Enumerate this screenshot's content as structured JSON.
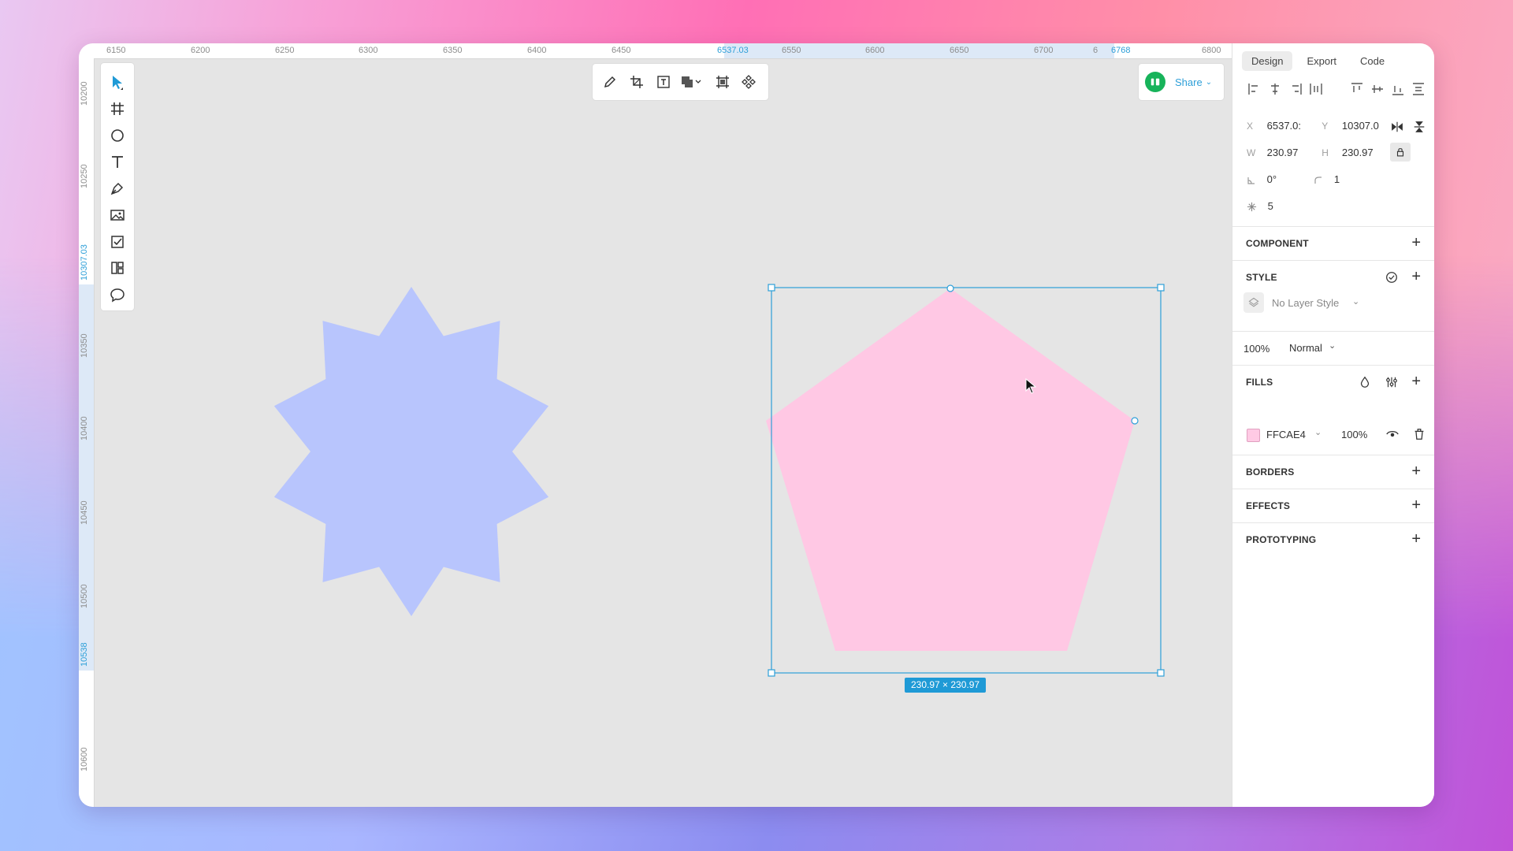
{
  "ruler_top": {
    "labels": [
      "6150",
      "6200",
      "6250",
      "6300",
      "6350",
      "6400",
      "6450",
      "6537.03",
      "6550",
      "6600",
      "6650",
      "6700",
      "6",
      "6768",
      "6800"
    ],
    "highlight": [
      "6537.03",
      "6768"
    ]
  },
  "ruler_left": {
    "labels": [
      "10200",
      "10250",
      "10307.03",
      "10350",
      "10400",
      "10450",
      "10500",
      "10538",
      "10600"
    ],
    "highlight": [
      "10307.03",
      "10538"
    ]
  },
  "tools": [
    "select-tool",
    "frame-tool",
    "ellipse-tool",
    "text-tool",
    "pen-tool",
    "image-tool",
    "checkbox-tool",
    "component-tool",
    "comment-tool"
  ],
  "top_tools": [
    "edit-pencil",
    "crop",
    "text-box",
    "boolean-union",
    "mask",
    "component"
  ],
  "share": {
    "label": "Share"
  },
  "canvas": {
    "star_color": "#b8c5fd",
    "pentagon_color": "#ffc8e4",
    "selection_size": "230.97 × 230.97",
    "selection_color": "#2d9fd8"
  },
  "panel": {
    "tabs": [
      "Design",
      "Export",
      "Code"
    ],
    "active_tab": "Design",
    "x_label": "X",
    "x_value": "6537.0:",
    "y_label": "Y",
    "y_value": "10307.0",
    "w_label": "W",
    "w_value": "230.97",
    "h_label": "H",
    "h_value": "230.97",
    "rotation_value": "0°",
    "radius_value": "1",
    "points_value": "5",
    "component_title": "COMPONENT",
    "style_title": "STYLE",
    "layer_style": "No Layer Style",
    "opacity": "100%",
    "blend_mode": "Normal",
    "fills_title": "FILLS",
    "fill_hex": "FFCAE4",
    "fill_swatch": "#ffcae4",
    "fill_opacity": "100%",
    "borders_title": "BORDERS",
    "effects_title": "EFFECTS",
    "prototyping_title": "PROTOTYPING"
  }
}
